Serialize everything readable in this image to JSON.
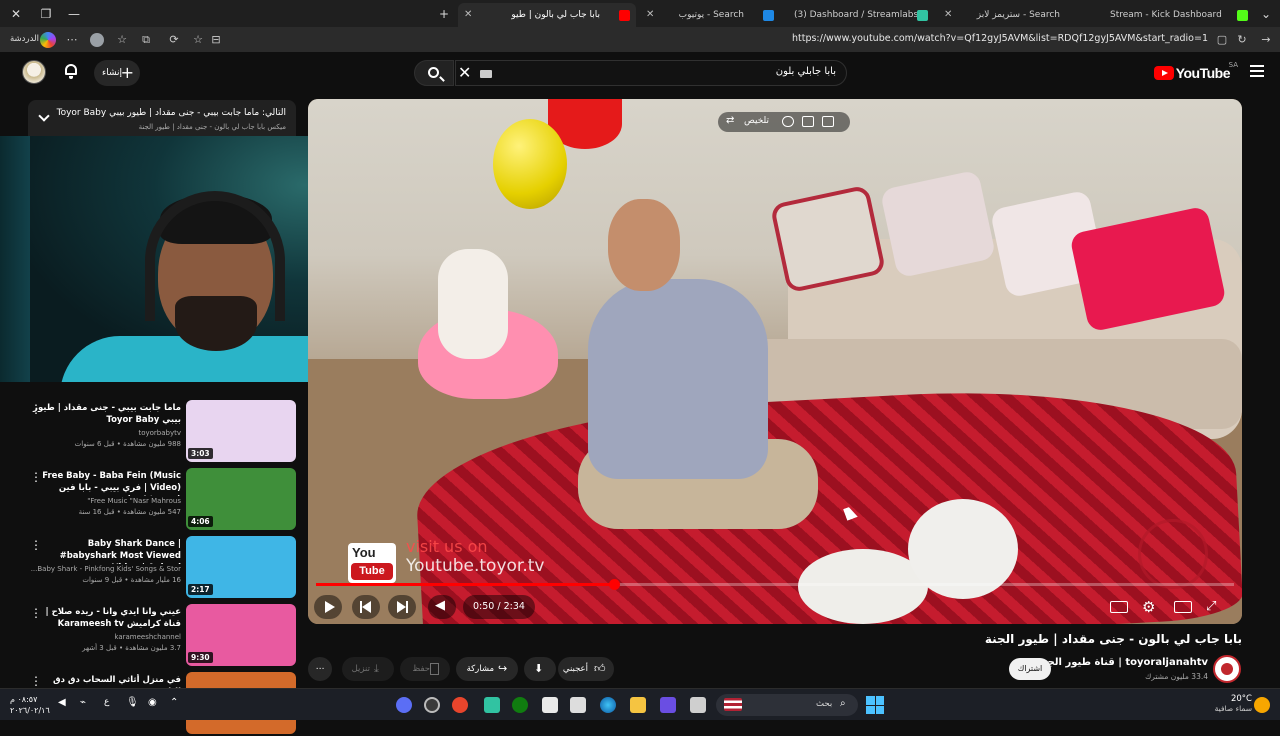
{
  "browser": {
    "tabs": [
      {
        "label": "Stream - Kick Dashboard",
        "active": false
      },
      {
        "label": "Search - ستريمز لابز",
        "active": false
      },
      {
        "label": "(3) Dashboard / Streamlabs",
        "active": false
      },
      {
        "label": "Search - يوتيوب",
        "active": false
      },
      {
        "label": "بابا جاب لي بالون | طيو",
        "active": true
      }
    ],
    "profile_label": "الدردشة",
    "url": "https://www.youtube.com/watch?v=Qf12gyJ5AVM&list=RDQf12gyJ5AVM&start_radio=1"
  },
  "header": {
    "logo_text": "YouTube",
    "region": "SA",
    "search_query": "بابا جابلي بلون",
    "create_label": "إنشاء"
  },
  "playlist": {
    "now_playing": "التالي: ماما جابت بيبي - جنى مقداد | طيور بيبي Toyor Baby",
    "subtitle": "ميكس بابا جاب لي بالون - جنى مقداد | طيور الجنة"
  },
  "recommendations": [
    {
      "title": "ماما جابت بيبي - جنى مقداد | طيور بيبي Toyor Baby",
      "channel": "toyorbabytv",
      "meta": "988 مليون مشاهدة • قبل 6 سنوات",
      "duration": "3:03",
      "thumb": "#e8d5f0"
    },
    {
      "title": "Free Baby - Baba Fein (Music Video) | فري بيبي - بابا فين (فيديو كليب)",
      "channel": "Free Music \"Nasr Mahrous\"",
      "meta": "547 مليون مشاهدة • قبل 16 سنة",
      "duration": "4:06",
      "thumb": "#3f8f3a"
    },
    {
      "title": "Baby Shark Dance | #babyshark Most Viewed Video | Animal ...",
      "channel": "Baby Shark - Pinkfong Kids' Songs & Stor...",
      "meta": "16 مليار مشاهدة • قبل 9 سنوات",
      "duration": "2:17",
      "thumb": "#3fb6e6"
    },
    {
      "title": "عيني وانا ايدي وانا - ريده صلاح | قناة كراميش Karameesh tv",
      "channel": "karameeshchannel",
      "meta": "3.7 مليون مشاهدة • قبل 3 أشهر",
      "duration": "9:30",
      "thumb": "#e85aa0"
    },
    {
      "title": "في منزل أثاثي السحاب دق دق الباب",
      "channel": "",
      "meta": "",
      "duration": "",
      "thumb": "#d36a2a"
    }
  ],
  "video": {
    "overlay_label": "تلخيص",
    "watermark_visit": "visit us on",
    "watermark_url": "Youtube.toyor.tv",
    "badge_you": "You",
    "badge_tube": "Tube",
    "time": "0:50 / 2:34",
    "progress_fraction": 0.325,
    "title": "بابا جاب لي بالون - جنى مقداد | طيور الجنة",
    "channel": "toyoraljanahtv | قناة طيور الجنة",
    "subscribers": "33.4 مليون مشترك",
    "subscribe_label": "اشتراك"
  },
  "actions": {
    "like": "أعجبني",
    "share": "مشاركة",
    "save": "حفظ",
    "download": "تنزيل"
  },
  "taskbar": {
    "search": "بحث",
    "temp": "20°C",
    "weather": "سماء صافية",
    "time": "٠٨:٥٧ م",
    "date": "٢٠٢٦/٠٢/١٦"
  }
}
